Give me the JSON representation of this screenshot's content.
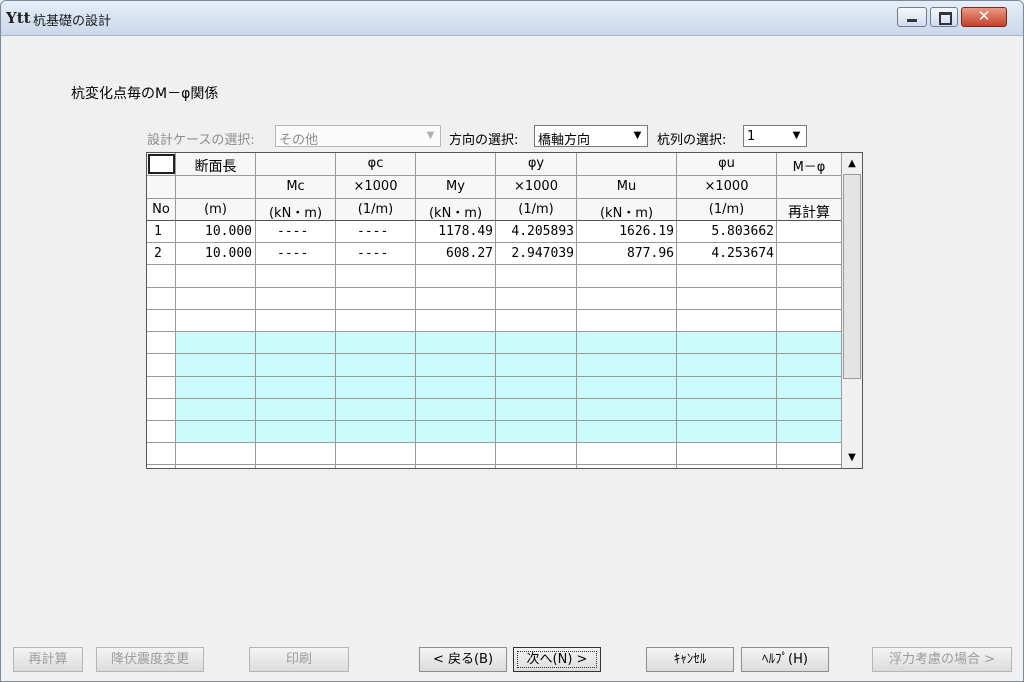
{
  "window": {
    "title": "杭基礎の設計",
    "app_icon": "Ytt"
  },
  "heading": "杭変化点毎のM－φ関係",
  "filters": {
    "case_label": "設計ケースの選択:",
    "case_value": "その他",
    "direction_label": "方向の選択:",
    "direction_value": "橋軸方向",
    "pile_label": "杭列の選択:",
    "pile_value": "1"
  },
  "table": {
    "header_row1": [
      "",
      "断面長",
      "",
      "φc",
      "",
      "φy",
      "",
      "φu",
      "M－φ"
    ],
    "header_row2": [
      "",
      "",
      "Mc",
      "×1000",
      "My",
      "×1000",
      "Mu",
      "×1000",
      ""
    ],
    "header_row3": [
      "No",
      "(m)",
      "(kN・m)",
      "(1/m)",
      "(kN・m)",
      "(1/m)",
      "(kN・m)",
      "(1/m)",
      "再計算"
    ],
    "rows": [
      [
        "1",
        "10.000",
        "----",
        "----",
        "1178.49",
        "4.205893",
        "1626.19",
        "5.803662",
        ""
      ],
      [
        "2",
        "10.000",
        "----",
        "----",
        "608.27",
        "2.947039",
        "877.96",
        "4.253674",
        ""
      ]
    ]
  },
  "buttons": {
    "recalc": "再計算",
    "yield_change": "降伏震度変更",
    "print": "印刷",
    "back": "< 戻る(B)",
    "next": "次へ(N) >",
    "cancel": "ｷｬﾝｾﾙ",
    "help": "ﾍﾙﾌﾟ(H)",
    "buoyancy": "浮力考慮の場合 >"
  },
  "colors": {
    "cyan_rows": "#ccfbfb",
    "close_button": "#c6402a"
  }
}
